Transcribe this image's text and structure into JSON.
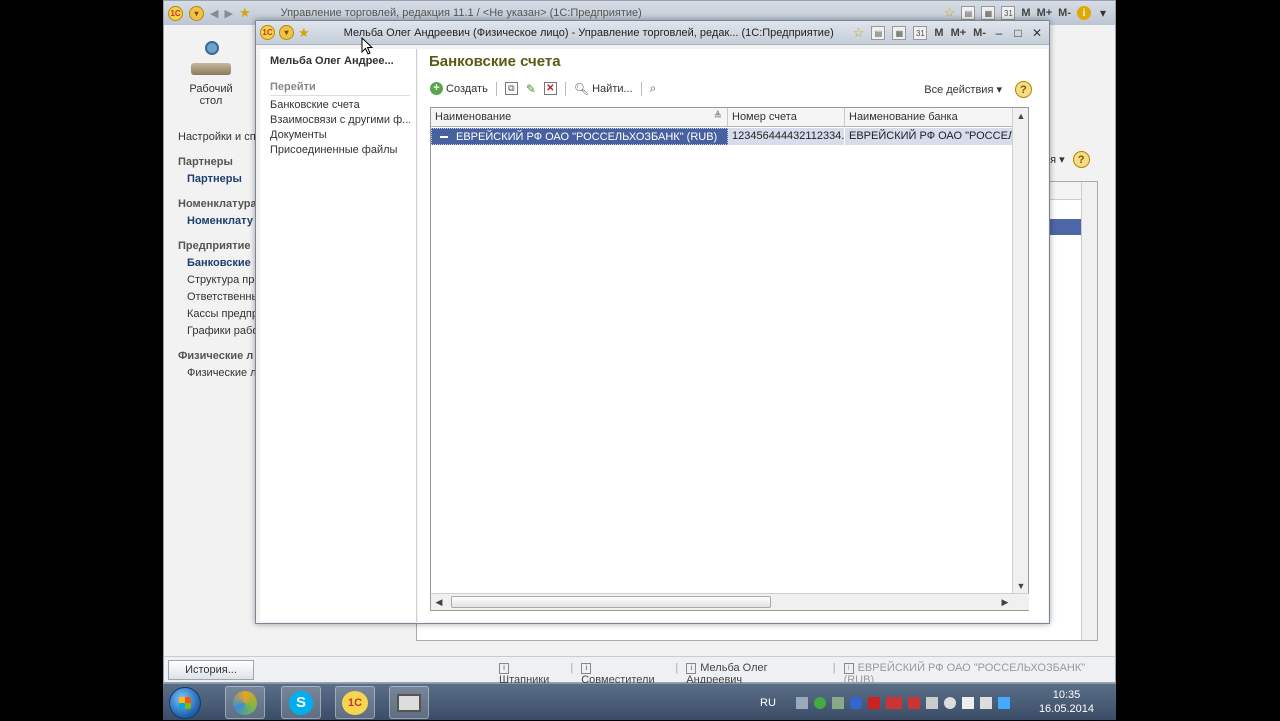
{
  "main_window": {
    "title": "Управление торговлей, редакция 11.1 / <Не указан>  (1С:Предприятие)",
    "toolbar_right": [
      "M",
      "M+",
      "M-"
    ],
    "desktop_button": {
      "line1": "Рабочий",
      "line2": "стол"
    },
    "nav": {
      "settings": "Настройки и спр",
      "groups": [
        {
          "label": "Партнеры",
          "items": [
            {
              "label": "Партнеры",
              "selected": true
            }
          ]
        },
        {
          "label": "Номенклатура",
          "items": [
            {
              "label": "Номенклату",
              "selected": true
            }
          ]
        },
        {
          "label": "Предприятие",
          "items": [
            {
              "label": "Банковские",
              "selected": true
            },
            {
              "label": "Структура пре",
              "selected": false
            },
            {
              "label": "Ответственны",
              "selected": false
            },
            {
              "label": "Кассы предпр",
              "selected": false
            },
            {
              "label": "Графики рабо",
              "selected": false
            }
          ]
        },
        {
          "label": "Физические л",
          "items": [
            {
              "label": "Физические л",
              "selected": false
            }
          ]
        }
      ]
    },
    "right_fragment": "ия ▾",
    "help": "?"
  },
  "statusbar": {
    "history_label": "История...",
    "open_windows": [
      "Штапники",
      "Совместители",
      "Мельба Олег Андреевич",
      "ЕВРЕЙСКИЙ РФ ОАО \"РОССЕЛЬХОЗБАНК\" (RUB)"
    ]
  },
  "dialog": {
    "title": "Мельба Олег Андреевич (Физическое лицо) - Управление торговлей, редак...  (1С:Предприятие)",
    "title_right": [
      "M",
      "M+",
      "M-"
    ],
    "left_panel": {
      "owner": "Мельба Олег Андрее...",
      "goto_label": "Перейти",
      "links": [
        "Банковские счета",
        "Взаимосвязи с другими ф...",
        "Документы",
        "Присоединенные файлы"
      ]
    },
    "heading": "Банковские счета",
    "toolbar": {
      "create_label": "Создать",
      "find_label": "Найти...",
      "all_actions": "Все действия ▾"
    },
    "grid": {
      "columns": [
        "Наименование",
        "Номер счета",
        "Наименование банка"
      ],
      "rows": [
        {
          "name": "ЕВРЕЙСКИЙ РФ ОАО \"РОССЕЛЬХОЗБАНК\" (RUB)",
          "account": "123456444432112334...",
          "bank": "ЕВРЕЙСКИЙ РФ ОАО \"РОССЕЛЬ"
        }
      ]
    }
  },
  "taskbar": {
    "lang": "RU",
    "time": "10:35",
    "date": "16.05.2014"
  }
}
